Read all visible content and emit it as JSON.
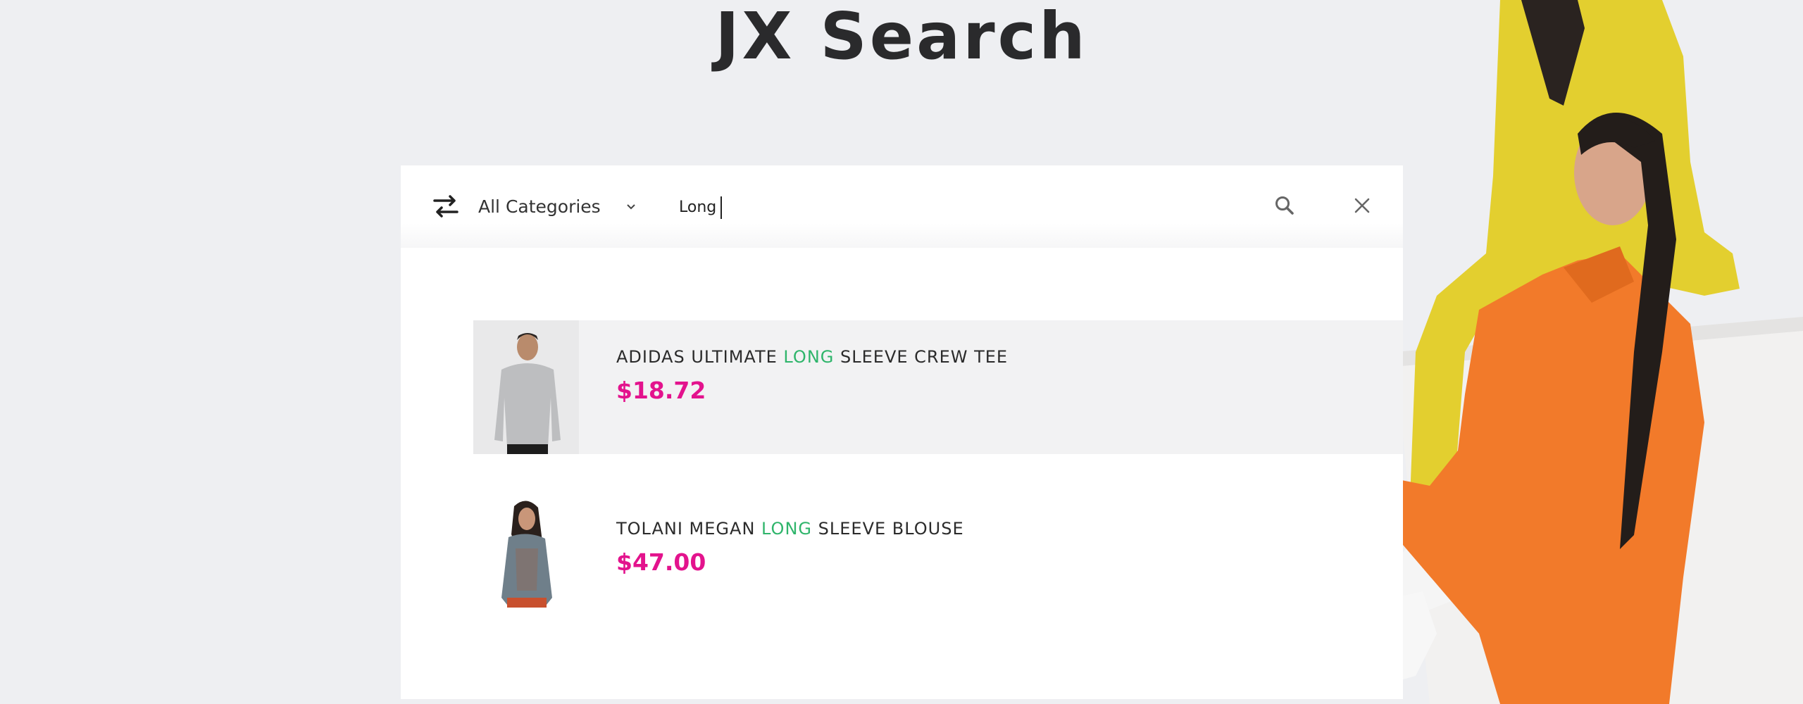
{
  "page": {
    "title": "JX Search"
  },
  "search": {
    "category": "All Categories",
    "query": "Long",
    "icons": {
      "swap": "swap-arrows-icon",
      "chevron": "chevron-down-icon",
      "search": "search-icon",
      "close": "close-icon"
    }
  },
  "results": [
    {
      "name_before": "ADIDAS ULTIMATE ",
      "name_match": "LONG",
      "name_after": " SLEEVE CREW TEE",
      "price": "$18.72"
    },
    {
      "name_before": "TOLANI MEGAN ",
      "name_match": "LONG",
      "name_after": " SLEEVE BLOUSE",
      "price": "$47.00"
    }
  ],
  "colors": {
    "match": "#2fb56b",
    "price": "#e3138d",
    "background": "#eeeff2"
  }
}
